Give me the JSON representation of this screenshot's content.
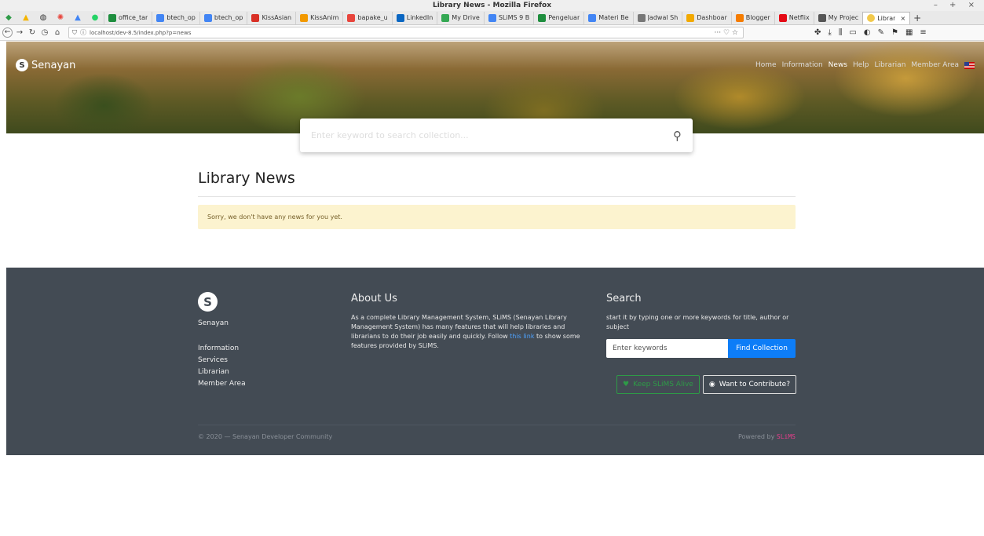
{
  "window": {
    "title": "Library News - Mozilla Firefox",
    "controls": "– + ×"
  },
  "tabs": [
    {
      "label": "office_tar",
      "color": "#1e8e3e"
    },
    {
      "label": "btech_op",
      "color": "#4285f4"
    },
    {
      "label": "btech_op",
      "color": "#4285f4"
    },
    {
      "label": "KissAsian",
      "color": "#d93025"
    },
    {
      "label": "KissAnim",
      "color": "#f29900"
    },
    {
      "label": "bapake_u",
      "color": "#e8453c"
    },
    {
      "label": "LinkedIn",
      "color": "#0a66c2"
    },
    {
      "label": "My Drive",
      "color": "#34a853"
    },
    {
      "label": "SLiMS 9 B",
      "color": "#4285f4"
    },
    {
      "label": "Pengeluar",
      "color": "#1e8e3e"
    },
    {
      "label": "Materi Be",
      "color": "#4285f4"
    },
    {
      "label": "Jadwal Sh",
      "color": "#777777"
    },
    {
      "label": "Dashboar",
      "color": "#f2a900"
    },
    {
      "label": "Blogger",
      "color": "#f57c00"
    },
    {
      "label": "Netflix",
      "color": "#e50914"
    },
    {
      "label": "My Projec",
      "color": "#555555"
    }
  ],
  "active_tab": {
    "label": "Librar",
    "close": "×"
  },
  "newtab": "+",
  "url": "localhost/dev-8.5/index.php?p=news",
  "url_actions": "··· ♡ ☆",
  "site": {
    "brand": "Senayan",
    "logo_glyph": "S",
    "menu": [
      "Home",
      "Information",
      "News",
      "Help",
      "Librarian",
      "Member Area"
    ],
    "search_placeholder": "Enter keyword to search collection...",
    "search_icon": "search-icon"
  },
  "news": {
    "title": "Library News",
    "empty_message": "Sorry, we don't have any news for you yet."
  },
  "footer": {
    "name": "Senayan",
    "links": [
      "Information",
      "Services",
      "Librarian",
      "Member Area"
    ],
    "about": {
      "title": "About Us",
      "text1": "As a complete Library Management System, SLiMS (Senayan Library Management System) has many features that will help libraries and librarians to do their job easily and quickly. Follow ",
      "link": "this link",
      "text2": " to show some features provided by SLiMS."
    },
    "search": {
      "title": "Search",
      "desc": "start it by typing one or more keywords for title, author or subject",
      "placeholder": "Enter keywords",
      "button": "Find Collection",
      "keep_alive": "Keep SLiMS Alive",
      "contribute": "Want to Contribute?"
    },
    "copyright": "© 2020 — Senayan Developer Community",
    "powered_prefix": "Powered by",
    "powered_brand": "SLiMS"
  }
}
